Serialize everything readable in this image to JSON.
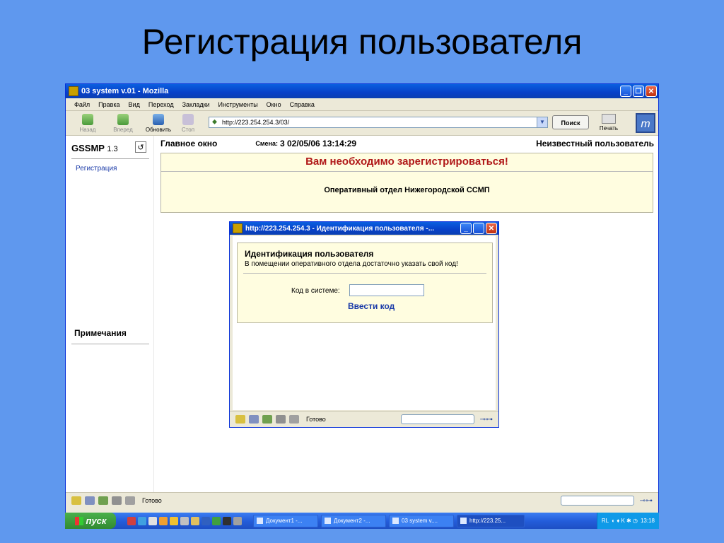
{
  "slide": {
    "title": "Регистрация пользователя"
  },
  "window": {
    "title": "03 system v.01 - Mozilla",
    "min": "_",
    "max": "❐",
    "close": "✕"
  },
  "menu": [
    "Файл",
    "Правка",
    "Вид",
    "Переход",
    "Закладки",
    "Инструменты",
    "Окно",
    "Справка"
  ],
  "toolbar": {
    "back": "Назад",
    "forward": "Вперед",
    "reload": "Обновить",
    "stop": "Стоп",
    "url": "http://223.254.254.3/03/",
    "search": "Поиск",
    "print": "Печать",
    "throbber": "m"
  },
  "sidebar": {
    "app": "GSSMP",
    "version": "1.3",
    "refresh": "↺",
    "link": "Регистрация",
    "notes": "Примечания"
  },
  "main": {
    "title": "Главное окно",
    "shift_label": "Смена:",
    "shift_value": "3  02/05/06   13:14:29",
    "user": "Неизвестный пользователь",
    "alert": "Вам необходимо зарегистрироваться!",
    "department": "Оперативный отдел Нижегородской ССМП"
  },
  "popup": {
    "title": "http://223.254.254.3 - Идентификация пользователя -...",
    "heading": "Идентификация пользователя",
    "subtitle": "В помещении оперативного отдела достаточно указать свой код!",
    "code_label": "Код в системе:",
    "code_value": "",
    "submit": "Ввести код",
    "status": "Готово"
  },
  "status": {
    "text": "Готово"
  },
  "taskbar": {
    "start": "пуск",
    "tasks": [
      "Документ1 -...",
      "Документ2 -...",
      "03 system v....",
      "http://223.25..."
    ],
    "lang": "RL",
    "clock": "13:18"
  }
}
